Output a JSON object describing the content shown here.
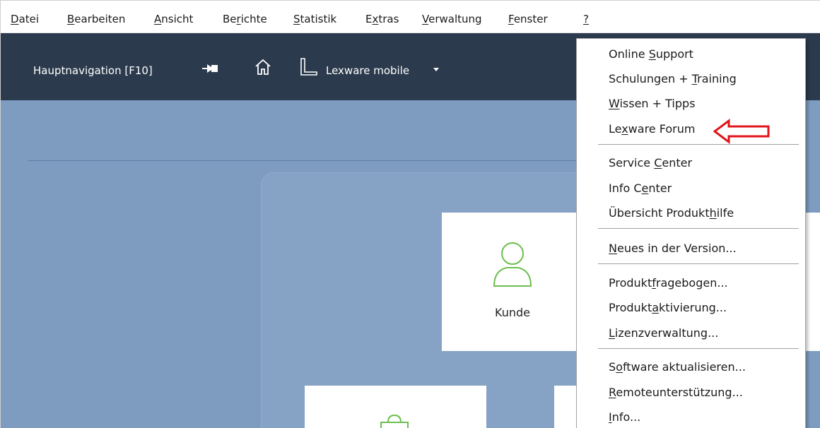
{
  "menubar": {
    "items": [
      {
        "label": "Datei",
        "mnemonic_index": 0
      },
      {
        "label": "Bearbeiten",
        "mnemonic_index": 0
      },
      {
        "label": "Ansicht",
        "mnemonic_index": 0
      },
      {
        "label": "Berichte",
        "mnemonic_index": 2
      },
      {
        "label": "Statistik",
        "mnemonic_index": 0
      },
      {
        "label": "Extras",
        "mnemonic_index": 1
      },
      {
        "label": "Verwaltung",
        "mnemonic_index": 0
      },
      {
        "label": "Fenster",
        "mnemonic_index": 0
      },
      {
        "label": "?",
        "mnemonic_index": 0
      }
    ]
  },
  "toolbar": {
    "nav_label": "Hauptnavigation [F10]",
    "mobile_label": "Lexware mobile",
    "icons": [
      "pin-icon",
      "home-icon",
      "lexware-logo-icon",
      "caret-down-icon"
    ]
  },
  "main": {
    "tiles": [
      {
        "label": "Kunde",
        "icon": "person-icon"
      }
    ]
  },
  "help_menu": {
    "items": [
      {
        "label": "Online Support",
        "mnemonic_index": 7,
        "group": 1
      },
      {
        "label": "Schulungen + Training",
        "mnemonic_index": 13,
        "group": 1
      },
      {
        "label": "Wissen + Tipps",
        "mnemonic_index": 0,
        "group": 1
      },
      {
        "label": "Lexware Forum",
        "mnemonic_index": 2,
        "group": 1
      },
      {
        "label": "Service Center",
        "mnemonic_index": 8,
        "group": 2
      },
      {
        "label": "Info Center",
        "mnemonic_index": 6,
        "group": 2
      },
      {
        "label": "Übersicht Produkthilfe",
        "mnemonic_index": 17,
        "group": 2
      },
      {
        "label": "Neues in der Version...",
        "mnemonic_index": 0,
        "group": 3
      },
      {
        "label": "Produktfragebogen...",
        "mnemonic_index": 7,
        "group": 4
      },
      {
        "label": "Produktaktivierung...",
        "mnemonic_index": 7,
        "group": 4
      },
      {
        "label": "Lizenzverwaltung...",
        "mnemonic_index": 0,
        "group": 4
      },
      {
        "label": "Software aktualisieren...",
        "mnemonic_index": 1,
        "group": 5
      },
      {
        "label": "Remoteunterstützung...",
        "mnemonic_index": 0,
        "group": 5
      },
      {
        "label": "Info...",
        "mnemonic_index": 0,
        "group": 5
      }
    ]
  },
  "annotation": {
    "type": "arrow-left",
    "color": "#e0141b",
    "points_to": "Lexware Forum"
  },
  "colors": {
    "toolbar_bg": "#2b3a4d",
    "main_bg": "#7d9cc0",
    "icon_green": "#6cbf4f",
    "annotation_red": "#e0141b"
  }
}
